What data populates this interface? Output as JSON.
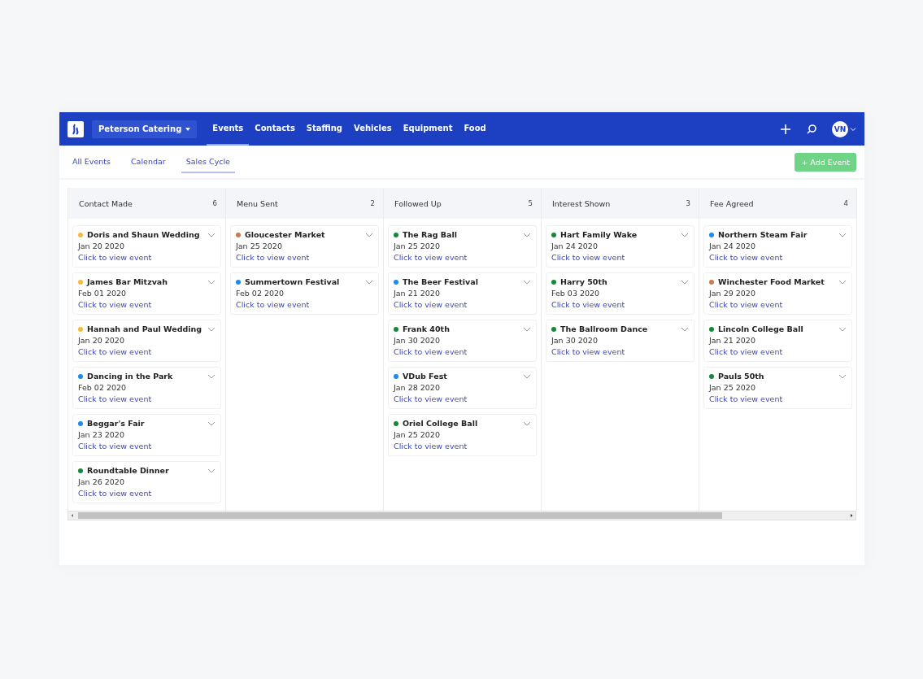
{
  "nav": {
    "workspace": "Peterson Catering",
    "items": [
      {
        "label": "Events",
        "selected": true
      },
      {
        "label": "Contacts",
        "selected": false
      },
      {
        "label": "Staffing",
        "selected": false
      },
      {
        "label": "Vehicles",
        "selected": false
      },
      {
        "label": "Equipment",
        "selected": false
      },
      {
        "label": "Food",
        "selected": false
      }
    ],
    "avatar": "VN"
  },
  "subtabs": [
    {
      "label": "All Events",
      "selected": false
    },
    {
      "label": "Calendar",
      "selected": false
    },
    {
      "label": "Sales Cycle",
      "selected": true
    }
  ],
  "add_button": "+ Add Event",
  "columns": [
    {
      "title": "Contact Made",
      "count": "6",
      "cards": [
        {
          "name": "Doris and Shaun Wedding",
          "date": "Jan 20 2020",
          "link": "Click to view event",
          "color": "#f9b93a"
        },
        {
          "name": "James Bar Mitzvah",
          "date": "Feb 01 2020",
          "link": "Click to view event",
          "color": "#f9b93a"
        },
        {
          "name": "Hannah and Paul Wedding",
          "date": "Jan 20 2020",
          "link": "Click to view event",
          "color": "#f9b93a"
        },
        {
          "name": "Dancing in the Park",
          "date": "Feb 02 2020",
          "link": "Click to view event",
          "color": "#1a8cf0"
        },
        {
          "name": "Beggar's Fair",
          "date": "Jan 23 2020",
          "link": "Click to view event",
          "color": "#1a8cf0"
        },
        {
          "name": "Roundtable Dinner",
          "date": "Jan 26 2020",
          "link": "Click to view event",
          "color": "#138a3a"
        }
      ]
    },
    {
      "title": "Menu Sent",
      "count": "2",
      "cards": [
        {
          "name": "Gloucester Market",
          "date": "Jan 25 2020",
          "link": "Click to view event",
          "color": "#c97d4e"
        },
        {
          "name": "Summertown Festival",
          "date": "Feb 02 2020",
          "link": "Click to view event",
          "color": "#1a8cf0"
        }
      ]
    },
    {
      "title": "Followed Up",
      "count": "5",
      "cards": [
        {
          "name": "The Rag Ball",
          "date": "Jan 25 2020",
          "link": "Click to view event",
          "color": "#138a3a"
        },
        {
          "name": "The Beer Festival",
          "date": "Jan 21 2020",
          "link": "Click to view event",
          "color": "#1a8cf0"
        },
        {
          "name": "Frank 40th",
          "date": "Jan 30 2020",
          "link": "Click to view event",
          "color": "#138a3a"
        },
        {
          "name": "VDub Fest",
          "date": "Jan 28 2020",
          "link": "Click to view event",
          "color": "#1a8cf0"
        },
        {
          "name": "Oriel College Ball",
          "date": "Jan 25 2020",
          "link": "Click to view event",
          "color": "#138a3a"
        }
      ]
    },
    {
      "title": "Interest Shown",
      "count": "3",
      "cards": [
        {
          "name": "Hart Family Wake",
          "date": "Jan 24 2020",
          "link": "Click to view event",
          "color": "#138a3a"
        },
        {
          "name": "Harry 50th",
          "date": "Feb 03 2020",
          "link": "Click to view event",
          "color": "#138a3a"
        },
        {
          "name": "The Ballroom Dance",
          "date": "Jan 30 2020",
          "link": "Click to view event",
          "color": "#138a3a"
        }
      ]
    },
    {
      "title": "Fee Agreed",
      "count": "4",
      "cards": [
        {
          "name": "Northern Steam Fair",
          "date": "Jan 24 2020",
          "link": "Click to view event",
          "color": "#1a8cf0"
        },
        {
          "name": "Winchester Food Market",
          "date": "Jan 29 2020",
          "link": "Click to view event",
          "color": "#c97d4e"
        },
        {
          "name": "Lincoln College Ball",
          "date": "Jan 21 2020",
          "link": "Click to view event",
          "color": "#138a3a"
        },
        {
          "name": "Pauls 50th",
          "date": "Jan 25 2020",
          "link": "Click to view event",
          "color": "#138a3a"
        }
      ]
    }
  ]
}
